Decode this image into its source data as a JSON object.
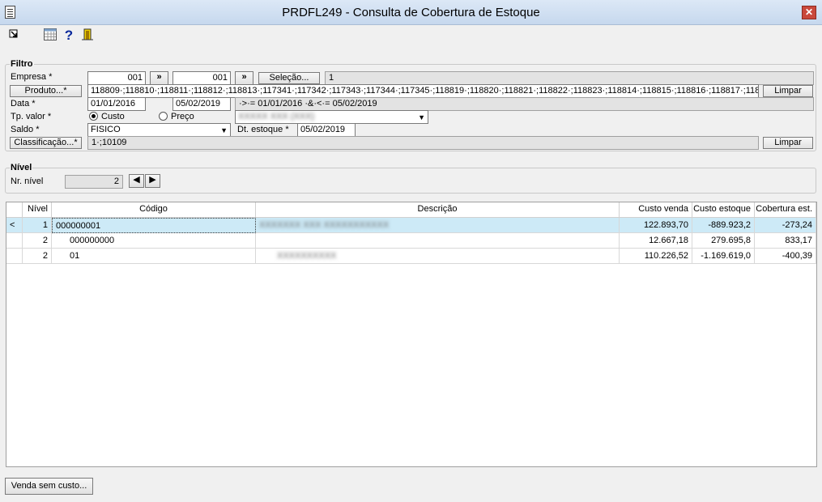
{
  "window": {
    "title": "PRDFL249 - Consulta de Cobertura de Estoque",
    "close_glyph": "✕"
  },
  "toolbar": {
    "icons": [
      "exit-icon",
      "calendar-grid-icon",
      "help-icon",
      "door-icon"
    ],
    "help_glyph": "?"
  },
  "filtro": {
    "group_title": "Filtro",
    "empresa": {
      "label": "Empresa *",
      "from": "001",
      "to": "001",
      "more": "»",
      "selecao_button": "Seleção...",
      "selecao_value": "1"
    },
    "produto": {
      "button": "Produto...*",
      "value": "118809·;118810·;118811·;118812·;118813·;117341·;117342·;117343·;117344·;117345·;118819·;118820·;118821·;118822·;118823·;118814·;118815·;118816·;118817·;1188",
      "limpar": "Limpar"
    },
    "data": {
      "label": "Data *",
      "from": "01/01/2016",
      "to": "05/02/2019",
      "summary": "·>·= 01/01/2016 ·&·<·= 05/02/2019"
    },
    "tp_valor": {
      "label": "Tp. valor *",
      "option1": "Custo",
      "option2": "Preço",
      "selected": "Custo",
      "dropdown_value": "XXXXX XXX (XXX)"
    },
    "saldo": {
      "label": "Saldo *",
      "value": "FISICO",
      "dt_estoque_label": "Dt. estoque *",
      "dt_estoque_value": "05/02/2019"
    },
    "classificacao": {
      "button": "Classificação...*",
      "value": "1·;10109",
      "limpar": "Limpar"
    }
  },
  "nivel": {
    "group_title": "Nível",
    "label": "Nr. nível",
    "value": "2",
    "prev": "◀",
    "next": "▶"
  },
  "table": {
    "columns": [
      "",
      "Nível",
      "Código",
      "Descrição",
      "Custo venda",
      "Custo estoque",
      "Cobertura est."
    ],
    "rows": [
      {
        "marker": "<",
        "nivel": "1",
        "codigo": "000000001",
        "descricao": "XXXXXXX XXX XXXXXXXXXXX",
        "custo_venda": "122.893,70",
        "custo_estoque": "-889.923,2",
        "cobertura": "-273,24"
      },
      {
        "marker": "",
        "nivel": "2",
        "codigo": "000000000",
        "descricao": "",
        "custo_venda": "12.667,18",
        "custo_estoque": "279.695,8",
        "cobertura": "833,17"
      },
      {
        "marker": "",
        "nivel": "2",
        "codigo": "01",
        "descricao": "XXXXXXXXXX",
        "custo_venda": "110.226,52",
        "custo_estoque": "-1.169.619,0",
        "cobertura": "-400,39"
      }
    ]
  },
  "footer": {
    "venda_sem_custo": "Venda sem custo..."
  }
}
